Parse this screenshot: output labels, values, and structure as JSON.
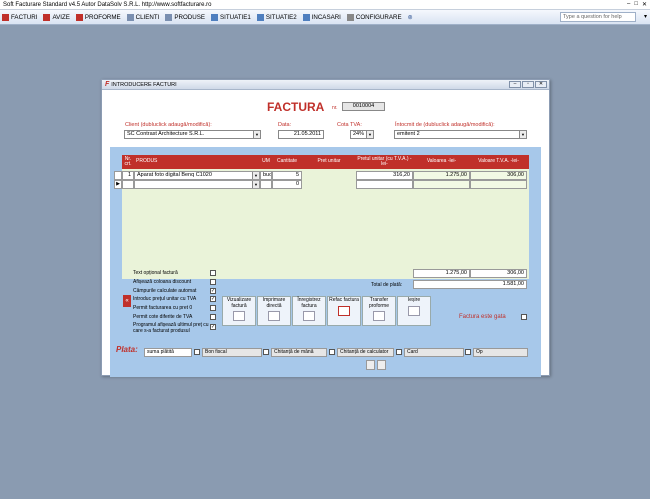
{
  "app": {
    "title": "Soft Facturare Standard v4.5 Autor DataSolv S.R.L. http://www.softfacturare.ro",
    "menu": [
      "FACTURI",
      "AVIZE",
      "PROFORME",
      "CLIENTI",
      "PRODUSE",
      "SITUATIE1",
      "SITUATIE2",
      "INCASARI",
      "CONFIGURARE"
    ],
    "question_placeholder": "Type a question for help"
  },
  "window": {
    "title": "INTRODUCERE FACTURI",
    "heading": "FACTURA",
    "nr_label": "nr.",
    "nr_value": "0010004"
  },
  "form": {
    "client_label": "Client (dubluclick adaugă/modifică):",
    "client_value": "SC Contrast Architecture S.R.L.",
    "data_label": "Data:",
    "data_value": "21.05.2011",
    "cota_label": "Cota TVA:",
    "cota_value": "24%",
    "intocmit_label": "Întocmit de (dubluclick adaugă/modifică):",
    "intocmit_value": "emitent 2"
  },
  "grid": {
    "headers": {
      "nr": "Nr. crt.",
      "produs": "PRODUS",
      "um": "UM",
      "cantitate": "Cantitate",
      "pret": "Pret unitar",
      "pret_tva": "Pretul unitar (cu T.V.A.) -lei-",
      "valoarea": "Valoarea -lei-",
      "valoare_tva": "Valoare T.V.A. -lei-"
    },
    "rows": [
      {
        "nr": "1",
        "produs": "Aparat foto digital Benq C1020",
        "um": "buc",
        "cantitate": "5",
        "pret": "",
        "pret_tva": "316,20",
        "valoarea": "1.275,00",
        "valoare_tva": "306,00"
      },
      {
        "nr": "",
        "produs": "",
        "um": "",
        "cantitate": "0",
        "pret": "",
        "pret_tva": "",
        "valoarea": "",
        "valoare_tva": ""
      }
    ]
  },
  "totals": {
    "valoarea": "1.275,00",
    "tva": "306,00",
    "total_label": "Total de plată:",
    "total_value": "1.581,00"
  },
  "options": [
    {
      "label": "Text opțional factură",
      "checked": false
    },
    {
      "label": "Afișează coloana discount",
      "checked": false
    },
    {
      "label": "Câmpurile calculate automat",
      "checked": true
    },
    {
      "label": "Introduc prețul unitar cu TVA",
      "checked": true
    },
    {
      "label": "Permit facturarea cu pret 0",
      "checked": false
    },
    {
      "label": "Permit cote diferite de TVA",
      "checked": false
    },
    {
      "label": "Programul afișează ultimul preț cu care s-a facturat produsul",
      "checked": true
    }
  ],
  "buttons": [
    {
      "label": "Vizualizare factură"
    },
    {
      "label": "Imprimare directă"
    },
    {
      "label": "Înregistrez factura"
    },
    {
      "label": "Refac factura"
    },
    {
      "label": "Transfer proforme"
    },
    {
      "label": "Ieșire"
    }
  ],
  "factura_gata": "Factura este gata",
  "plata": {
    "label": "Plata:",
    "suma": "suma plătită",
    "methods": [
      "Bon fiscal",
      "Chitanță de mână",
      "Chitanță de calculator",
      "Card",
      "Op"
    ]
  }
}
